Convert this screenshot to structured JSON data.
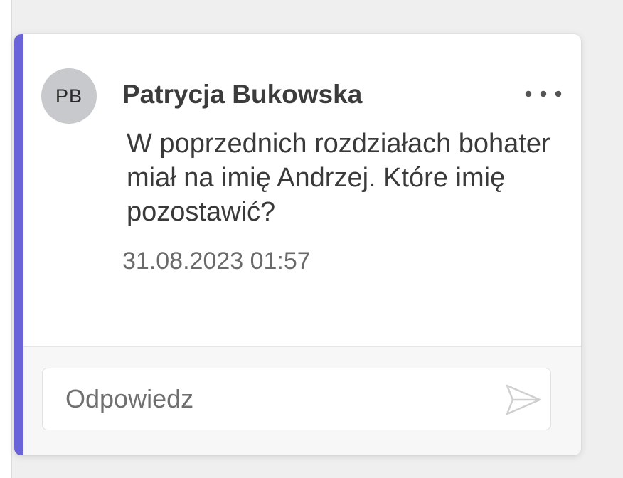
{
  "comment": {
    "author_initials": "PB",
    "author_name": "Patrycja Bukowska",
    "text": "W poprzednich rozdziałach bohater miał na imię Andrzej. Które imię pozostawić?",
    "timestamp": "31.08.2023 01:57",
    "menu_icon": "more-horizontal-icon",
    "accent_color": "#6b63d8"
  },
  "reply": {
    "placeholder": "Odpowiedz",
    "value": "",
    "send_icon": "send-icon"
  }
}
